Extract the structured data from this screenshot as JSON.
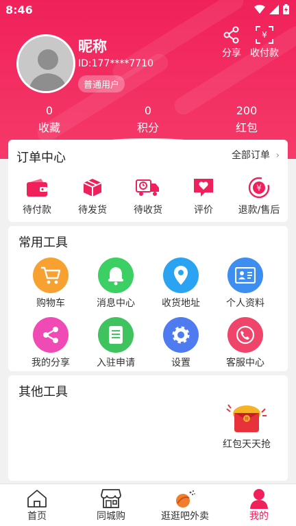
{
  "status_bar": {
    "time": "8:46"
  },
  "header": {
    "nickname": "昵称",
    "user_id": "ID:177****7710",
    "level": "普通用户",
    "share_label": "分享",
    "receive_label": "收付款",
    "stats": [
      {
        "value": "0",
        "label": "收藏"
      },
      {
        "value": "0",
        "label": "积分"
      },
      {
        "value": "200",
        "label": "红包"
      }
    ]
  },
  "orders": {
    "title": "订单中心",
    "all_label": "全部订单",
    "items": [
      {
        "label": "待付款",
        "icon": "wallet-icon"
      },
      {
        "label": "待发货",
        "icon": "box-icon"
      },
      {
        "label": "待收货",
        "icon": "truck-icon"
      },
      {
        "label": "评价",
        "icon": "heart-message-icon"
      },
      {
        "label": "退款/售后",
        "icon": "refund-icon"
      }
    ]
  },
  "tools": {
    "title": "常用工具",
    "items": [
      {
        "label": "购物车",
        "icon": "cart-icon",
        "color": "#f7a130"
      },
      {
        "label": "消息中心",
        "icon": "bell-icon",
        "color": "#3ccf63"
      },
      {
        "label": "收货地址",
        "icon": "location-icon",
        "color": "#2aa4f2"
      },
      {
        "label": "个人资料",
        "icon": "id-card-icon",
        "color": "#3d8ef0"
      },
      {
        "label": "我的分享",
        "icon": "share-icon",
        "color": "#f04bb4"
      },
      {
        "label": "入驻申请",
        "icon": "document-icon",
        "color": "#3fc35e"
      },
      {
        "label": "设置",
        "icon": "gear-icon",
        "color": "#4e7cf0"
      },
      {
        "label": "客服中心",
        "icon": "phone-icon",
        "color": "#f0456a"
      }
    ]
  },
  "other_tools": {
    "title": "其他工具",
    "items": [
      {
        "label": "红包天天抢",
        "icon": "red-packet-icon"
      }
    ]
  },
  "tabbar": {
    "items": [
      {
        "label": "首页",
        "icon": "home-icon"
      },
      {
        "label": "同城购",
        "icon": "store-icon"
      },
      {
        "label": "逛逛吧外卖",
        "icon": "takeout-icon"
      },
      {
        "label": "我的",
        "icon": "user-icon"
      }
    ],
    "active_index": 3
  },
  "colors": {
    "primary": "#f0215a",
    "background": "#f1f1f1"
  }
}
